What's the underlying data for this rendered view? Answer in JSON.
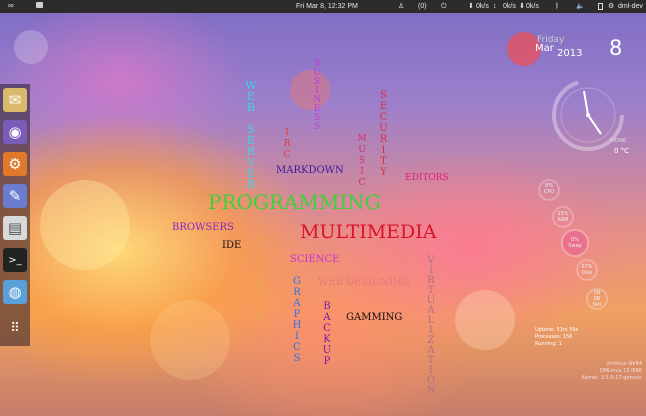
{
  "topbar": {
    "datetime": "Fri Mar 8, 12:32 PM",
    "mail_count": "(0)",
    "net_down": "0k/s",
    "net_up": "0k/s",
    "net_down2": "0k/s",
    "net_up2": "0k/s",
    "user": "dml-dev"
  },
  "launcher": {
    "items": [
      "mail-app",
      "disc-app",
      "settings-app",
      "text-editor-app",
      "files-app",
      "terminal-app",
      "browser-app",
      "apps-grid"
    ]
  },
  "words": {
    "web_server": "WEB SERVER",
    "business": "BUSINESS",
    "security": "SECURITY",
    "irc": "IRC",
    "music": "MUSIC",
    "markdown": "MARKDOWN",
    "editors": "EDITORS",
    "programming": "PROGRAMMING",
    "browsers": "BROWSERS",
    "ide": "IDE",
    "database": "DATABASE",
    "multimedia": "MULTIMEDIA",
    "science": "SCIENCE",
    "web_designing": "WEB DESIGNING",
    "virtualization": "VIRTUALIZATION",
    "graphics": "GRAPHICS",
    "backup": "BACKUP",
    "gamming": "GAMMING"
  },
  "clock": {
    "weekday": "Friday",
    "month": "Mar",
    "day": "8",
    "year": "2013",
    "home_label": "HOME",
    "temperature": "0 °C"
  },
  "stats": {
    "cpu_value": "8%",
    "cpu_label": "CPU",
    "ram_value": "25%",
    "ram_label": "RAM",
    "swap_value": "0%",
    "swap_label": "Swap",
    "disk_value": "67%",
    "disk_label": "Disk",
    "net_value1": "0B",
    "net_value2": "0B",
    "net_label": "Net"
  },
  "sysinfo": {
    "uptime": "Uptime: 31m 59s",
    "processes": "Processes: 156",
    "running": "Running: 1",
    "host": "dmlinux-NV44",
    "os": "DMLinux 13  i686",
    "kernel": "Kernel: 3.5.0-17-generic"
  },
  "colors": {
    "web_server": "#3fd3e6",
    "business": "#c33bd6",
    "security": "#e02a3c",
    "irc": "#e23a3a",
    "music": "#d6305f",
    "markdown": "#3a1a9a",
    "editors": "#e01f7a",
    "programming": "#3bd23b",
    "browsers": "#8a23c8",
    "ide": "#111111",
    "database": "#e6a64a",
    "multimedia": "#d8152a",
    "science": "#c733d2",
    "web_designing": "#e67878",
    "virtualization": "#a8708a",
    "graphics": "#2b73ea",
    "backup": "#7a18a8",
    "gamming": "#111111"
  }
}
